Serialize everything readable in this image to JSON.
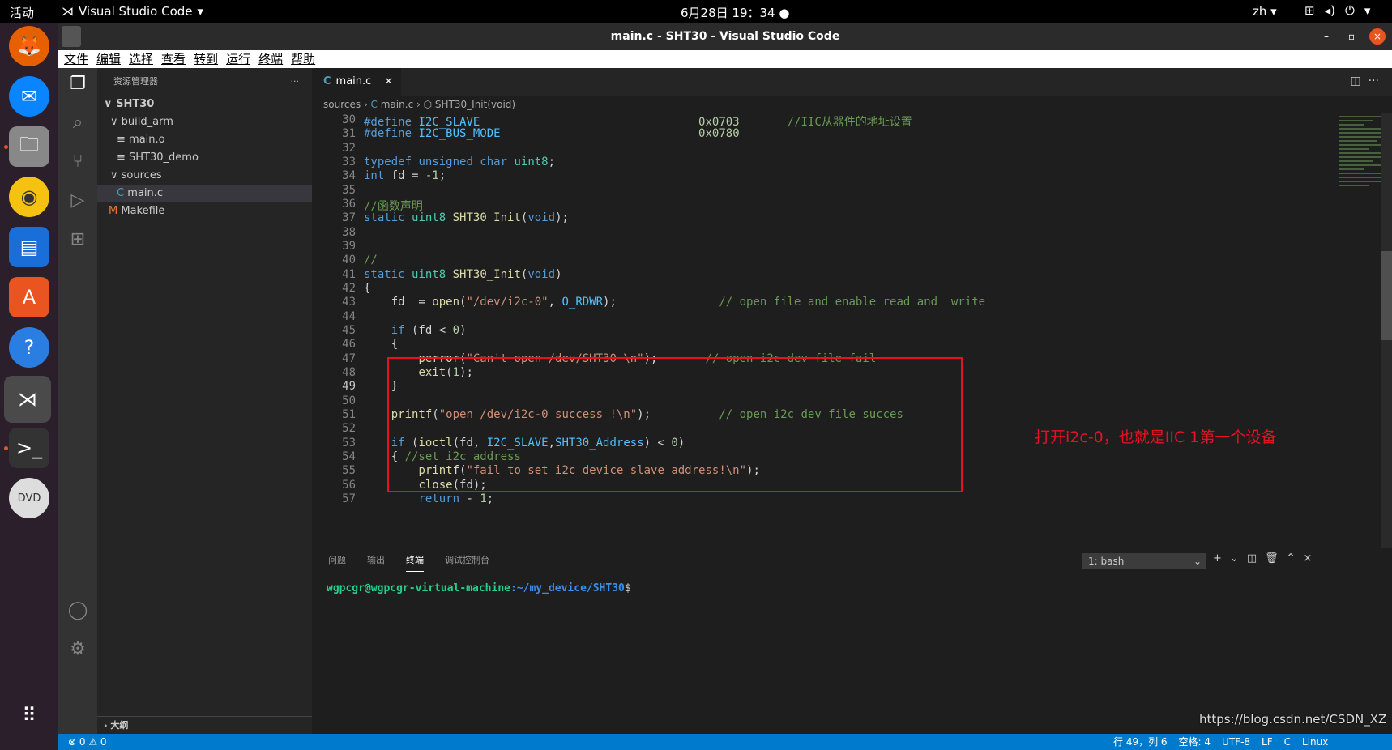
{
  "topbar": {
    "activities": "活动",
    "app": "Visual Studio Code",
    "clock": "6月28日 19：34",
    "lang": "zh"
  },
  "window": {
    "title": "main.c - SHT30 - Visual Studio Code"
  },
  "menu": [
    "文件",
    "编辑",
    "选择",
    "查看",
    "转到",
    "运行",
    "终端",
    "帮助"
  ],
  "sidebar": {
    "header": "资源管理器",
    "more": "···",
    "tree": [
      {
        "label": "SHT30",
        "indent": 8,
        "icon": "∨",
        "bold": true
      },
      {
        "label": "build_arm",
        "indent": 16,
        "icon": "∨"
      },
      {
        "label": "main.o",
        "indent": 24,
        "icon": "≡"
      },
      {
        "label": "SHT30_demo",
        "indent": 24,
        "icon": "≡"
      },
      {
        "label": "sources",
        "indent": 16,
        "icon": "∨"
      },
      {
        "label": "main.c",
        "indent": 24,
        "icon": "C",
        "sel": true
      },
      {
        "label": "Makefile",
        "indent": 14,
        "icon": "M"
      }
    ],
    "outline": "大纲"
  },
  "tab": {
    "icon": "C",
    "label": "main.c",
    "close": "×"
  },
  "breadcrumb": {
    "a": "sources",
    "b": "main.c",
    "c": "SHT30_Init(void)"
  },
  "annotation": "打开i2c-0，也就是IIC 1第一个设备",
  "panel": {
    "tabs": [
      "问题",
      "输出",
      "终端",
      "调试控制台"
    ],
    "active": 2,
    "select": "1: bash",
    "prompt_user": "wgpcgr@wgpcgr-virtual-machine",
    "prompt_path": ":~/my_device/SHT30",
    "prompt_end": "$"
  },
  "status": {
    "left": "⊗ 0 ⚠ 0",
    "items": [
      "行 49，列 6",
      "空格: 4",
      "UTF-8",
      "LF",
      "C",
      "Linux"
    ]
  },
  "watermark": "https://blog.csdn.net/CSDN_XZ"
}
